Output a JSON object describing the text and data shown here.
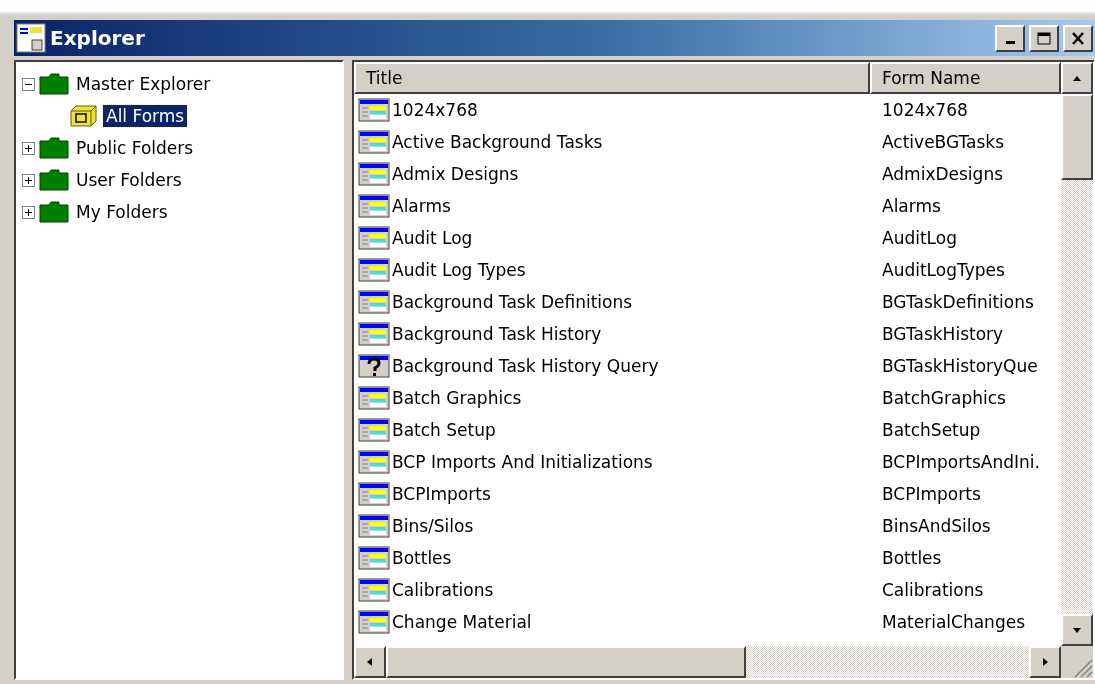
{
  "window": {
    "title": "Explorer"
  },
  "tree": [
    {
      "label": "Master Explorer",
      "kind": "folder",
      "expanded": true,
      "selected": false,
      "children": [
        {
          "label": "All Forms",
          "kind": "forms",
          "selected": true
        }
      ]
    },
    {
      "label": "Public Folders",
      "kind": "folder",
      "expanded": false,
      "selected": false
    },
    {
      "label": "User Folders",
      "kind": "folder",
      "expanded": false,
      "selected": false
    },
    {
      "label": "My Folders",
      "kind": "folder",
      "expanded": false,
      "selected": false
    }
  ],
  "table": {
    "columns": [
      "Title",
      "Form Name"
    ],
    "rows": [
      {
        "kind": "form",
        "title": "1024x768",
        "form_name": "1024x768"
      },
      {
        "kind": "form",
        "title": "Active Background Tasks",
        "form_name": "ActiveBGTasks"
      },
      {
        "kind": "form",
        "title": "Admix Designs",
        "form_name": "AdmixDesigns"
      },
      {
        "kind": "form",
        "title": "Alarms",
        "form_name": "Alarms"
      },
      {
        "kind": "form",
        "title": "Audit Log",
        "form_name": "AuditLog"
      },
      {
        "kind": "form",
        "title": "Audit Log Types",
        "form_name": "AuditLogTypes"
      },
      {
        "kind": "form",
        "title": "Background Task Definitions",
        "form_name": "BGTaskDefinitions"
      },
      {
        "kind": "form",
        "title": "Background Task History",
        "form_name": "BGTaskHistory"
      },
      {
        "kind": "query",
        "title": "Background Task History Query",
        "form_name": "BGTaskHistoryQue"
      },
      {
        "kind": "form",
        "title": "Batch Graphics",
        "form_name": "BatchGraphics"
      },
      {
        "kind": "form",
        "title": "Batch Setup",
        "form_name": "BatchSetup"
      },
      {
        "kind": "form",
        "title": "BCP Imports And Initializations",
        "form_name": "BCPImportsAndIni."
      },
      {
        "kind": "form",
        "title": "BCPImports",
        "form_name": "BCPImports"
      },
      {
        "kind": "form",
        "title": "Bins/Silos",
        "form_name": "BinsAndSilos"
      },
      {
        "kind": "form",
        "title": "Bottles",
        "form_name": "Bottles"
      },
      {
        "kind": "form",
        "title": "Calibrations",
        "form_name": "Calibrations"
      },
      {
        "kind": "form",
        "title": "Change Material",
        "form_name": "MaterialChanges"
      }
    ]
  }
}
